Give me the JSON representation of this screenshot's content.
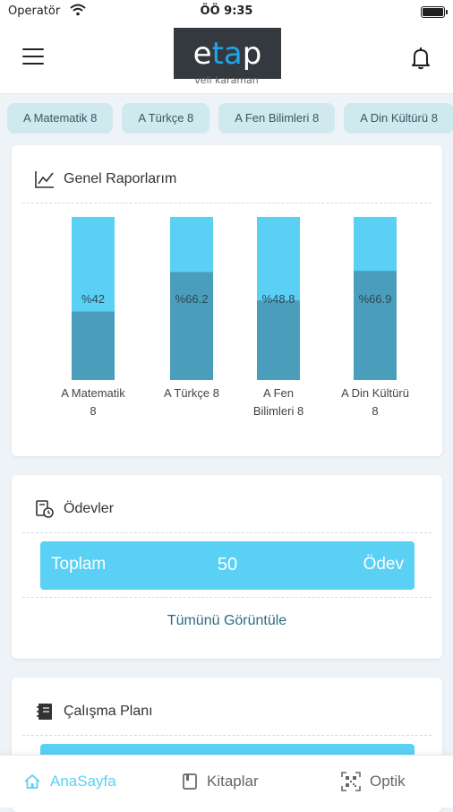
{
  "status_bar": {
    "carrier": "Operatör",
    "time": "ÖÖ 9:35"
  },
  "header": {
    "logo_text_1": "e",
    "logo_text_2": "ta",
    "logo_text_3": "p",
    "username": "veli karaman"
  },
  "tabs": [
    "A Matematik 8",
    "A Türkçe 8",
    "A Fen Bilimleri 8",
    "A Din Kültürü 8"
  ],
  "reports": {
    "title": "Genel Raporlarım",
    "chart_data": {
      "type": "bar",
      "categories": [
        "A Matematik 8",
        "A Türkçe 8",
        "A Fen Bilimleri 8",
        "A Din Kültürü 8"
      ],
      "category_lines": [
        [
          "A Matematik",
          "8"
        ],
        [
          "A Türkçe 8"
        ],
        [
          "A Fen",
          "Bilimleri 8"
        ],
        [
          "A Din Kültürü",
          "8"
        ]
      ],
      "values": [
        42,
        66.2,
        48.8,
        66.9
      ],
      "value_labels": [
        "%42",
        "%66.2",
        "%48.8",
        "%66.9"
      ],
      "ylim": [
        0,
        100
      ],
      "colors": {
        "filled": "#4a9ebc",
        "remaining": "#5ad0f5",
        "label": "#2a4a55"
      }
    }
  },
  "homework": {
    "title": "Ödevler",
    "total_label": "Toplam",
    "total_value": "50",
    "total_unit": "Ödev",
    "view_all": "Tümünü Görüntüle"
  },
  "study_plan": {
    "title": "Çalışma Planı"
  },
  "bottom_nav": {
    "home": "AnaSayfa",
    "books": "Kitaplar",
    "optik": "Optik"
  },
  "colors": {
    "accent": "#5ad0f5",
    "tab_bg": "#cfe9ee",
    "logo_bg": "#34393f"
  }
}
